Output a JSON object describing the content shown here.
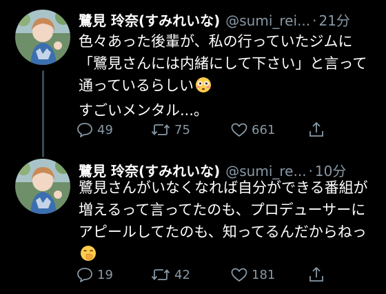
{
  "colors": {
    "background": "#000000",
    "text": "#ffffff",
    "secondary": "#8899a6",
    "thread_line": "#3b4a57"
  },
  "tweets": [
    {
      "display_name": "鷺見 玲奈(すみれいな)",
      "handle": "@sumi_rei...",
      "separator": "·",
      "time": "21分",
      "body_lines": [
        "色々あった後輩が、私の行っていたジムに",
        "「鷺見さんには内緒にして下さい」と言って",
        "通っているらしい",
        "すごいメンタル...。"
      ],
      "emoji": "flushed-face",
      "replies": "49",
      "retweets": "75",
      "likes": "661"
    },
    {
      "display_name": "鷺見 玲奈(すみれいな)",
      "handle": "@sumi_re...",
      "separator": "·",
      "time": "10分",
      "body_lines": [
        "鷺見さんがいなくなれば自分ができる番組が",
        "増えるって言ってたのも、プロデューサーに",
        "アピールしてたのも、知ってるんだからねっ",
        ""
      ],
      "emoji": "hand-over-mouth-face",
      "replies": "19",
      "retweets": "42",
      "likes": "181"
    }
  ]
}
